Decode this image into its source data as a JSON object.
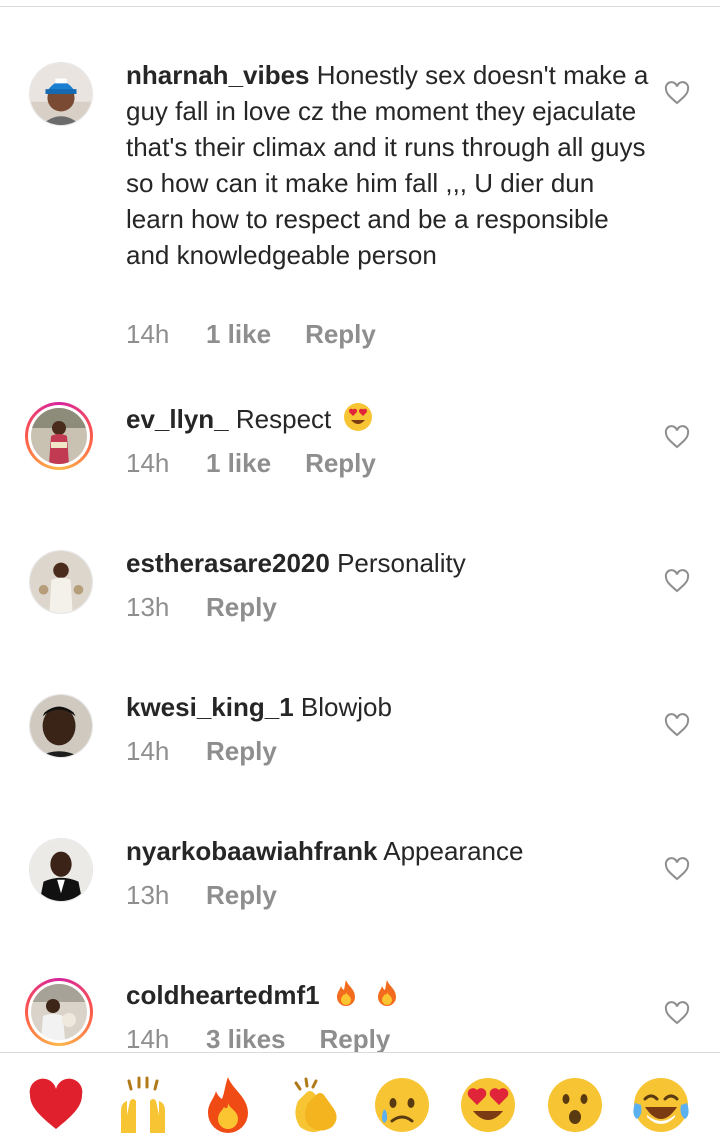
{
  "comments": [
    {
      "username": "nharnah_vibes",
      "text": "Honestly sex doesn't make a guy fall in love cz the moment they ejaculate that's their climax and it runs through all guys so how can it make him fall ,,, U dier dun learn how to respect and be a responsible and knowledgeable person",
      "time": "14h",
      "likes": "1 like",
      "reply": "Reply"
    },
    {
      "username": "ev_llyn_",
      "text": "Respect",
      "emoji": "heart-eyes-emoji",
      "time": "14h",
      "likes": "1 like",
      "reply": "Reply"
    },
    {
      "username": "estherasare2020",
      "text": "Personality",
      "time": "13h",
      "reply": "Reply"
    },
    {
      "username": "kwesi_king_1",
      "text": "Blowjob",
      "time": "14h",
      "reply": "Reply"
    },
    {
      "username": "nyarkobaawiahfrank",
      "text": "Appearance",
      "time": "13h",
      "reply": "Reply"
    },
    {
      "username": "coldheartedmf1",
      "text": "",
      "emoji": "fire-emoji fire-emoji",
      "time": "14h",
      "likes": "3 likes",
      "reply": "Reply"
    }
  ],
  "icons": {
    "like": "heart-outline-icon"
  },
  "quick_reactions": [
    "red-heart",
    "raising-hands",
    "fire",
    "clapping-hands",
    "sad-sweat-face",
    "heart-eyes",
    "surprised-face",
    "tears-of-joy"
  ],
  "colors": {
    "text": "#262626",
    "meta": "#8e8e8e",
    "story_ring_start": "#d6249f",
    "story_ring_end": "#fdb94a"
  }
}
